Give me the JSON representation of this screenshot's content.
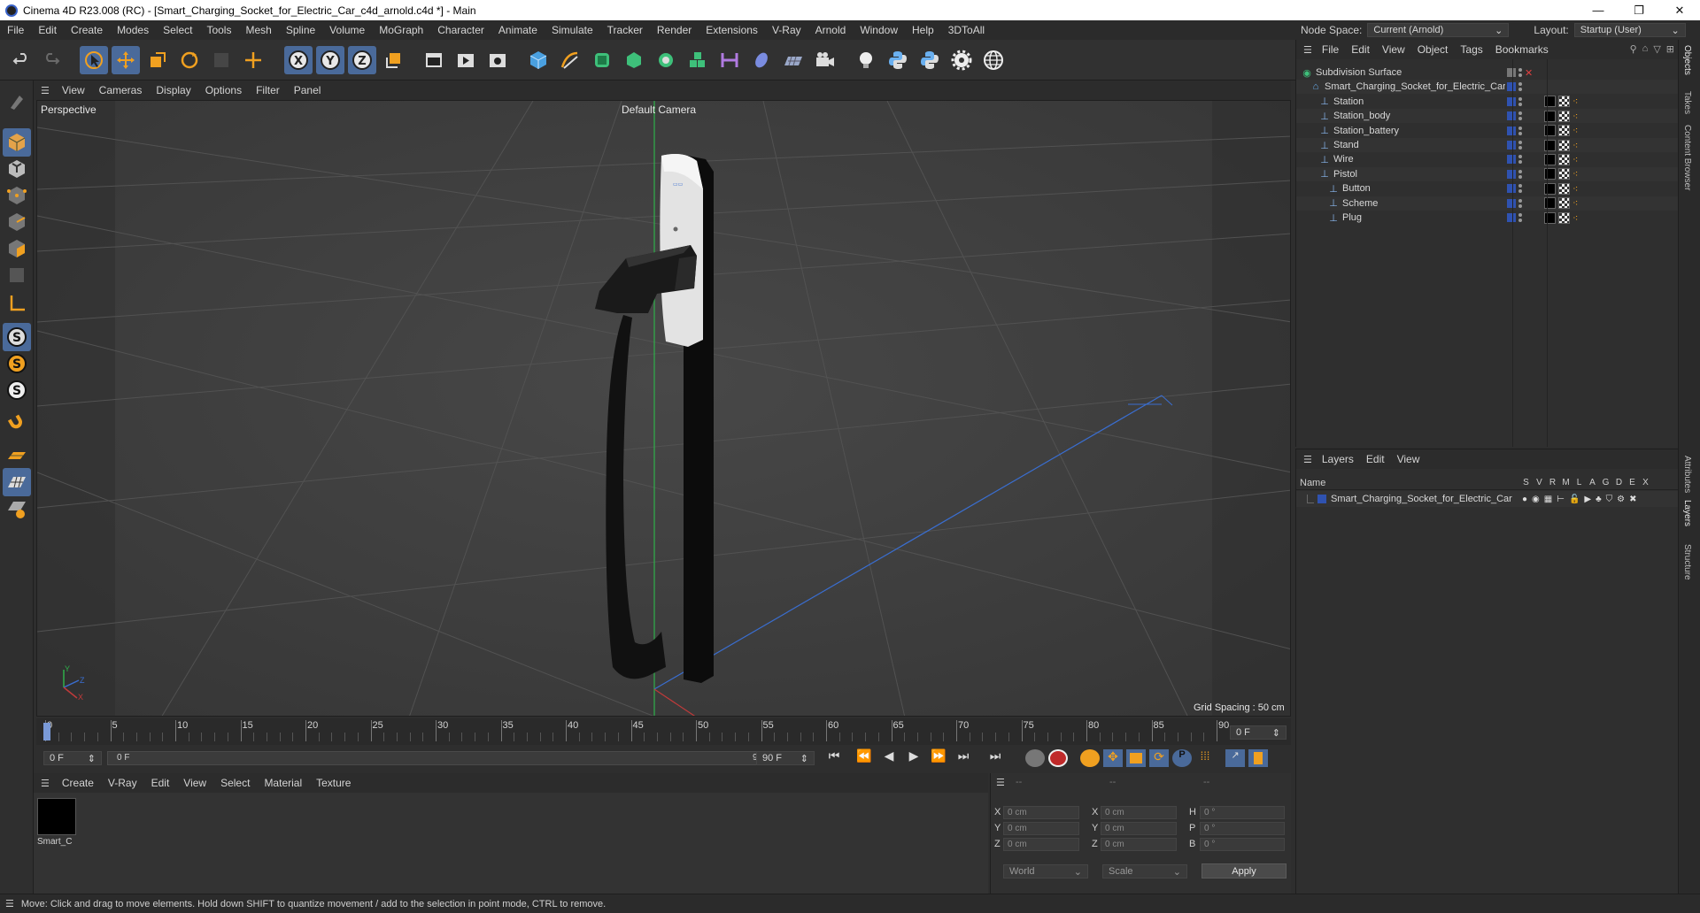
{
  "window": {
    "title": "Cinema 4D R23.008 (RC) - [Smart_Charging_Socket_for_Electric_Car_c4d_arnold.c4d *] - Main",
    "controls": [
      "—",
      "❐",
      "✕"
    ]
  },
  "menubar": {
    "items": [
      "File",
      "Edit",
      "Create",
      "Modes",
      "Select",
      "Tools",
      "Mesh",
      "Spline",
      "Volume",
      "MoGraph",
      "Character",
      "Animate",
      "Simulate",
      "Tracker",
      "Render",
      "Extensions",
      "V-Ray",
      "Arnold",
      "Window",
      "Help",
      "3DToAll"
    ]
  },
  "nodespace": {
    "label": "Node Space:",
    "value": "Current (Arnold)",
    "layout_label": "Layout:",
    "layout_value": "Startup (User)"
  },
  "viewport": {
    "menu": [
      "View",
      "Cameras",
      "Display",
      "Options",
      "Filter",
      "Panel"
    ],
    "name": "Perspective",
    "camera": "Default Camera",
    "grid_spacing": "Grid Spacing : 50 cm",
    "axis_labels": {
      "y": "Y",
      "z": "Z",
      "x": "X"
    }
  },
  "timeline": {
    "ticks": [
      "0",
      "5",
      "10",
      "15",
      "20",
      "25",
      "30",
      "35",
      "40",
      "45",
      "50",
      "55",
      "60",
      "65",
      "70",
      "75",
      "80",
      "85",
      "90"
    ],
    "current_frame": "0 F"
  },
  "playbar": {
    "start": "0 F",
    "range_start": "0 F",
    "range_end": "90 F",
    "end": "90 F"
  },
  "materials": {
    "menu": [
      "Create",
      "V-Ray",
      "Edit",
      "View",
      "Select",
      "Material",
      "Texture"
    ],
    "items": [
      {
        "label": "Smart_C"
      }
    ]
  },
  "coords": {
    "headers": [
      "--",
      "--",
      "--"
    ],
    "rows": [
      {
        "a": "X",
        "av": "0 cm",
        "b": "X",
        "bv": "0 cm",
        "c": "H",
        "cv": "0 °"
      },
      {
        "a": "Y",
        "av": "0 cm",
        "b": "Y",
        "bv": "0 cm",
        "c": "P",
        "cv": "0 °"
      },
      {
        "a": "Z",
        "av": "0 cm",
        "b": "Z",
        "bv": "0 cm",
        "c": "B",
        "cv": "0 °"
      }
    ],
    "mode": "World",
    "scale": "Scale",
    "apply": "Apply"
  },
  "objects": {
    "menu": [
      "File",
      "Edit",
      "View",
      "Object",
      "Tags",
      "Bookmarks"
    ],
    "tree": [
      {
        "name": "Subdivision Surface",
        "depth": 0
      },
      {
        "name": "Smart_Charging_Socket_for_Electric_Car",
        "depth": 1
      },
      {
        "name": "Station",
        "depth": 2
      },
      {
        "name": "Station_body",
        "depth": 2
      },
      {
        "name": "Station_battery",
        "depth": 2
      },
      {
        "name": "Stand",
        "depth": 2
      },
      {
        "name": "Wire",
        "depth": 2
      },
      {
        "name": "Pistol",
        "depth": 2
      },
      {
        "name": "Button",
        "depth": 3
      },
      {
        "name": "Scheme",
        "depth": 3
      },
      {
        "name": "Plug",
        "depth": 3
      }
    ]
  },
  "layers": {
    "menu": [
      "Layers",
      "Edit",
      "View"
    ],
    "name_header": "Name",
    "col_headers": [
      "S",
      "V",
      "R",
      "M",
      "L",
      "A",
      "G",
      "D",
      "E",
      "X"
    ],
    "items": [
      {
        "name": "Smart_Charging_Socket_for_Electric_Car"
      }
    ]
  },
  "right_tabs": [
    "Objects",
    "Takes",
    "Content Browser",
    "Attributes",
    "Layers",
    "Structure"
  ],
  "status": "Move: Click and drag to move elements. Hold down SHIFT to quantize movement / add to the selection in point mode, CTRL to remove.",
  "colors": {
    "accent": "#4a6a9a",
    "layer_blue": "#2f52b0",
    "orange": "#e08a1e"
  }
}
